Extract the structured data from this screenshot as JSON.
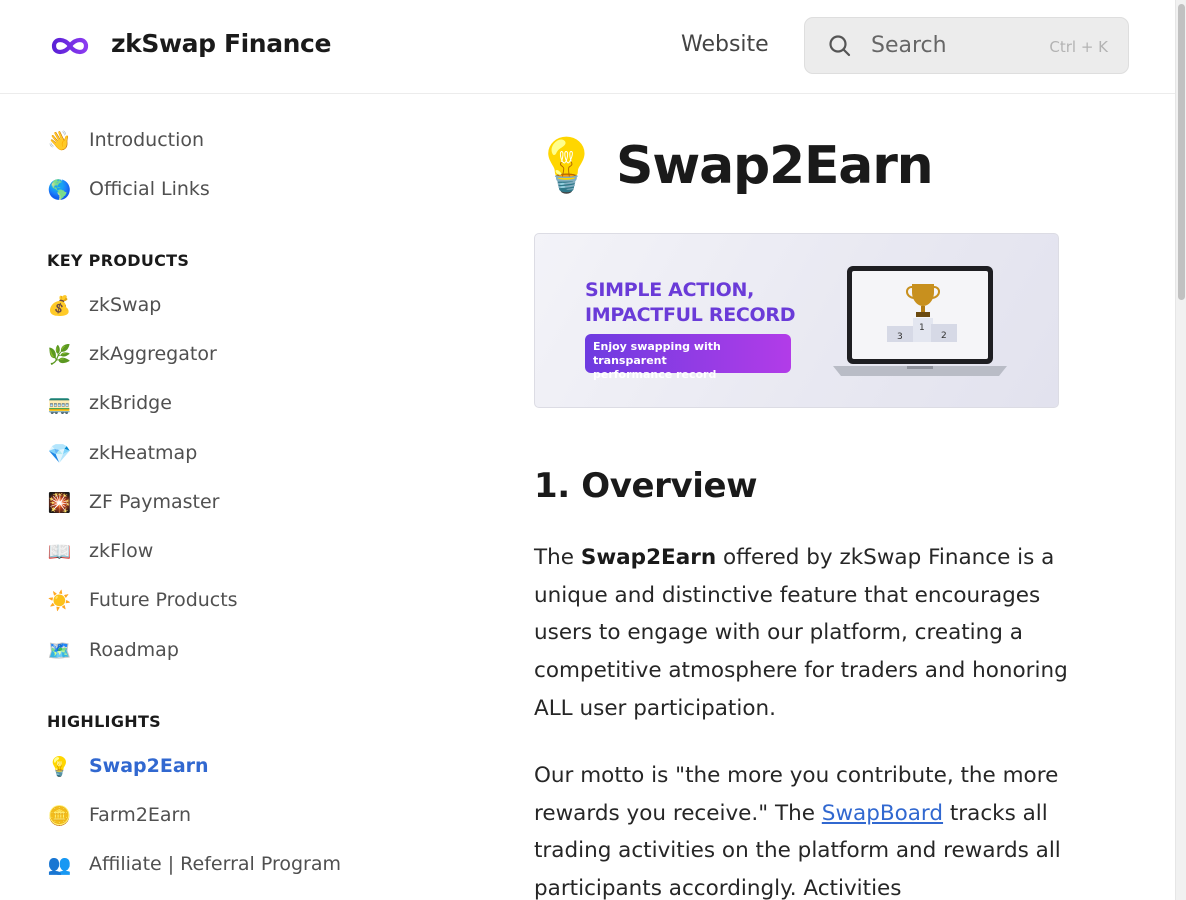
{
  "header": {
    "brand": "zkSwap Finance",
    "nav_website": "Website",
    "search_placeholder": "Search",
    "search_shortcut": "Ctrl + K"
  },
  "sidebar": {
    "top_items": [
      {
        "emoji": "👋",
        "label": "Introduction"
      },
      {
        "emoji": "🌎",
        "label": "Official Links"
      }
    ],
    "sections": [
      {
        "title": "KEY PRODUCTS",
        "items": [
          {
            "emoji": "💰",
            "label": "zkSwap"
          },
          {
            "emoji": "🌿",
            "label": "zkAggregator"
          },
          {
            "emoji": "🚃",
            "label": "zkBridge"
          },
          {
            "emoji": "💎",
            "label": "zkHeatmap"
          },
          {
            "emoji": "🎇",
            "label": "ZF Paymaster"
          },
          {
            "emoji": "📖",
            "label": "zkFlow"
          },
          {
            "emoji": "☀️",
            "label": "Future Products"
          },
          {
            "emoji": "🗺️",
            "label": "Roadmap"
          }
        ]
      },
      {
        "title": "HIGHLIGHTS",
        "items": [
          {
            "emoji": "💡",
            "label": "Swap2Earn"
          },
          {
            "emoji": "🪙",
            "label": "Farm2Earn"
          },
          {
            "emoji": "👥",
            "label": "Affiliate | Referral Program"
          }
        ]
      }
    ]
  },
  "main": {
    "title_emoji": "💡",
    "title": "Swap2Earn",
    "banner": {
      "headline_line1": "SIMPLE ACTION,",
      "headline_line2": "IMPACTFUL RECORD",
      "pill_line1": "Enjoy swapping with transparent",
      "pill_line2": "performance record"
    },
    "overview_heading": "1. Overview",
    "p1_intro": "The ",
    "p1_bold": "Swap2Earn",
    "p1_rest": " offered by zkSwap Finance is a unique and distinctive feature that encourages users to engage with our platform, creating a competitive atmosphere for traders and honoring ALL user participation.",
    "p2_intro": "Our motto is \"the more you contribute, the more rewards you receive.\" The ",
    "p2_link": "SwapBoard",
    "p2_rest": " tracks all trading activities on the platform and rewards all participants accordingly. Activities"
  },
  "colors": {
    "accent": "#3168d0",
    "logo_purple": "#7b2fe0",
    "banner_purple": "#6a3bd8"
  }
}
